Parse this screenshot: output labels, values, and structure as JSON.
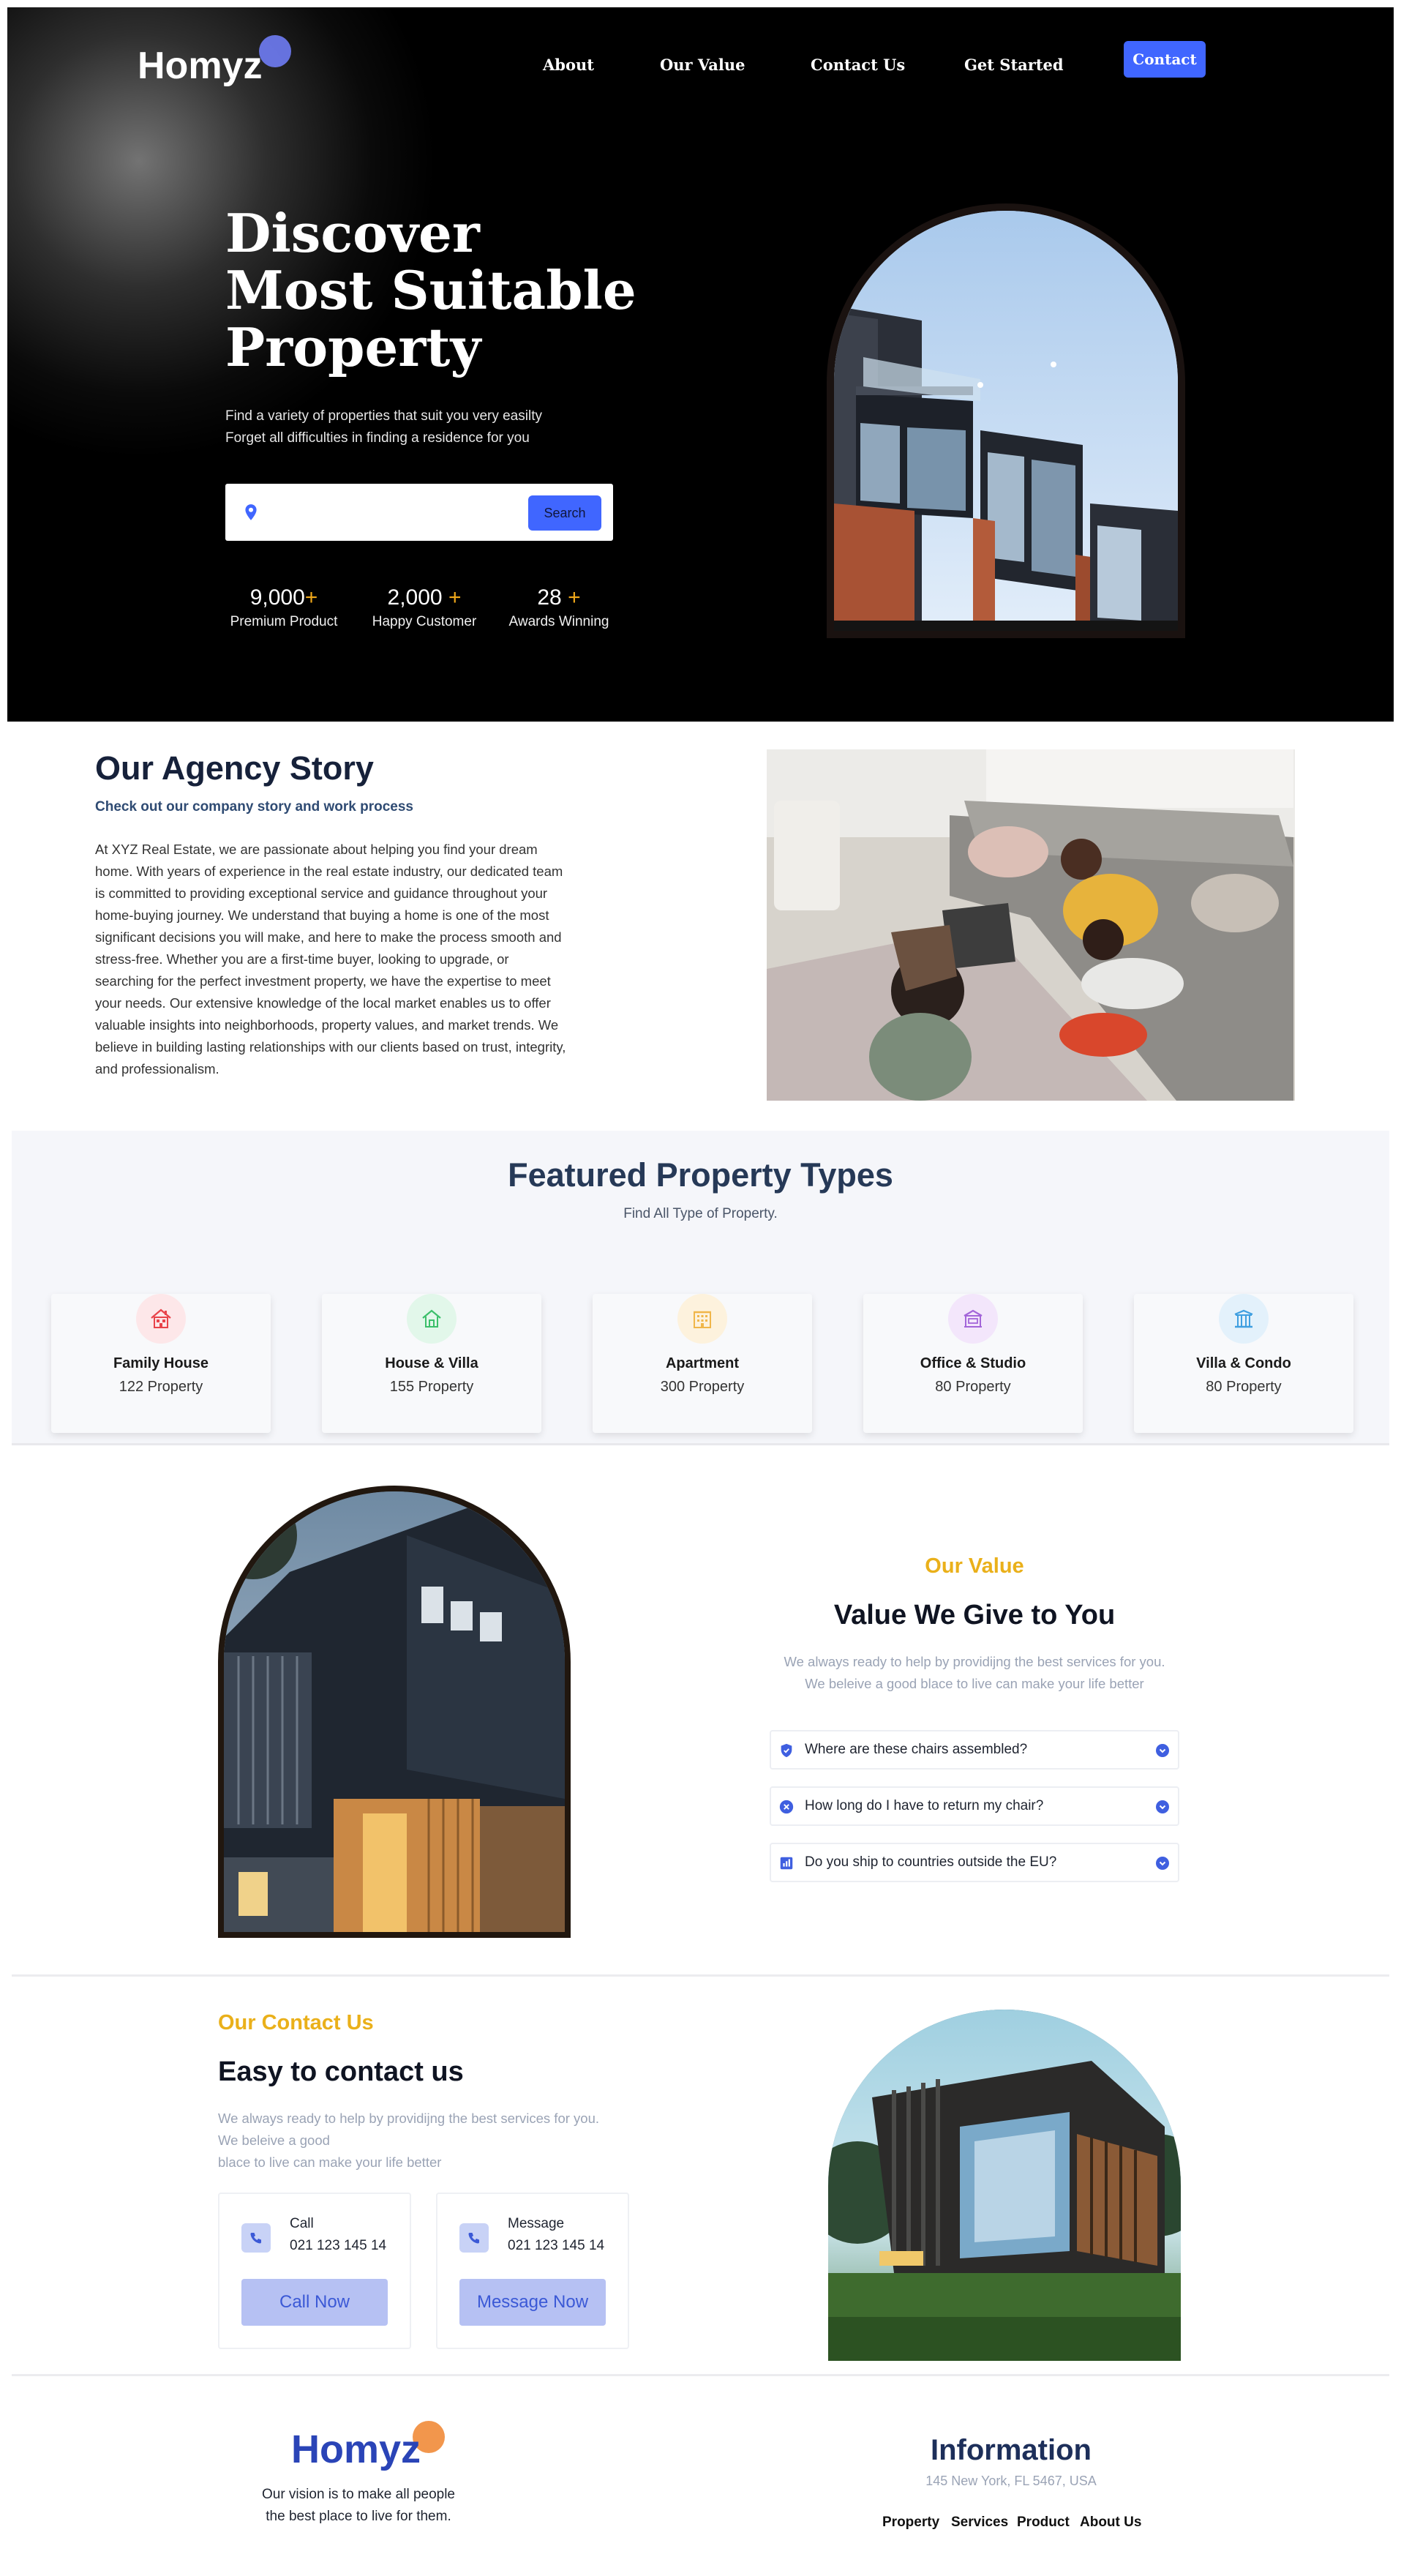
{
  "header": {
    "logo": "Homyz",
    "nav": [
      "About",
      "Our Value",
      "Contact Us",
      "Get Started"
    ],
    "contact_button": "Contact"
  },
  "hero": {
    "title_lines": [
      "Discover",
      "Most Suitable",
      "Property"
    ],
    "subtitle_lines": [
      "Find a variety of properties that suit you very easilty",
      "Forget all difficulties in finding a residence for you"
    ],
    "search": {
      "placeholder": "",
      "button": "Search"
    },
    "stats": [
      {
        "number": "9,000",
        "plus": "+",
        "label": "Premium Product"
      },
      {
        "number": "2,000",
        "plus": "+",
        "label": "Happy Customer"
      },
      {
        "number": "28",
        "plus": "+",
        "label": "Awards Winning"
      }
    ]
  },
  "story": {
    "title": "Our Agency Story",
    "subtitle": "Check out our company story and work process",
    "body": "At XYZ Real Estate, we are passionate about helping you find your dream home. With years of experience in the real estate industry, our dedicated team is committed to providing exceptional service and guidance throughout your home-buying journey. We understand that buying a home is one of the most significant decisions you will make, and here to make the process smooth and stress-free. Whether you are a first-time buyer, looking to upgrade, or searching for the perfect investment property, we have the expertise to meet your needs. Our extensive knowledge of the local market enables us to offer valuable insights into neighborhoods, property values, and market trends. We believe in building lasting relationships with our clients based on trust, integrity, and professionalism."
  },
  "featured": {
    "title": "Featured Property Types",
    "subtitle": "Find All Type of Property.",
    "types": [
      {
        "name": "Family House",
        "count": "122 Property",
        "icon": "house-roof-icon",
        "color": "#e8434a",
        "bg": "#fde7e9"
      },
      {
        "name": "House & Villa",
        "count": "155 Property",
        "icon": "house-icon",
        "color": "#3bbf6a",
        "bg": "#e2f7ea"
      },
      {
        "name": "Apartment",
        "count": "300 Property",
        "icon": "apartment-icon",
        "color": "#f0b64a",
        "bg": "#fdf2dd"
      },
      {
        "name": "Office & Studio",
        "count": "80 Property",
        "icon": "office-icon",
        "color": "#a365d9",
        "bg": "#f3e6fb"
      },
      {
        "name": "Villa & Condo",
        "count": "80 Property",
        "icon": "villa-icon",
        "color": "#3f9fe0",
        "bg": "#e3f1fb"
      }
    ]
  },
  "value": {
    "eyebrow": "Our Value",
    "title": "Value We Give to You",
    "desc_lines": [
      "We always ready to help by providijng the best services for you.",
      "We beleive a good blace to live can make your life better"
    ],
    "faqs": [
      {
        "q": "Where are these chairs assembled?",
        "icon": "shield-icon"
      },
      {
        "q": "How long do I have to return my chair?",
        "icon": "close-circle-icon"
      },
      {
        "q": "Do you ship to countries outside the EU?",
        "icon": "analytics-icon"
      }
    ]
  },
  "contact": {
    "eyebrow": "Our Contact Us",
    "title": "Easy to contact us",
    "desc_lines": [
      "We always ready to help by providijng the best services for you.",
      "We beleive a good",
      "blace to live can make your life better"
    ],
    "cards": [
      {
        "label": "Call",
        "number": "021 123 145 14",
        "button": "Call Now",
        "icon": "phone-icon"
      },
      {
        "label": "Message",
        "number": "021 123 145 14",
        "button": "Message Now",
        "icon": "phone-icon"
      }
    ]
  },
  "footer": {
    "logo": "Homyz",
    "vision_lines": [
      "Our vision is to make all people",
      "the best place to live for them."
    ],
    "info_title": "Information",
    "address": "145 New York, FL 5467, USA",
    "links": [
      "Property",
      "Services",
      "Product",
      "About Us"
    ]
  },
  "colors": {
    "accent": "#4066ff",
    "gold": "#eab01a",
    "navy": "#1d2f5a"
  }
}
